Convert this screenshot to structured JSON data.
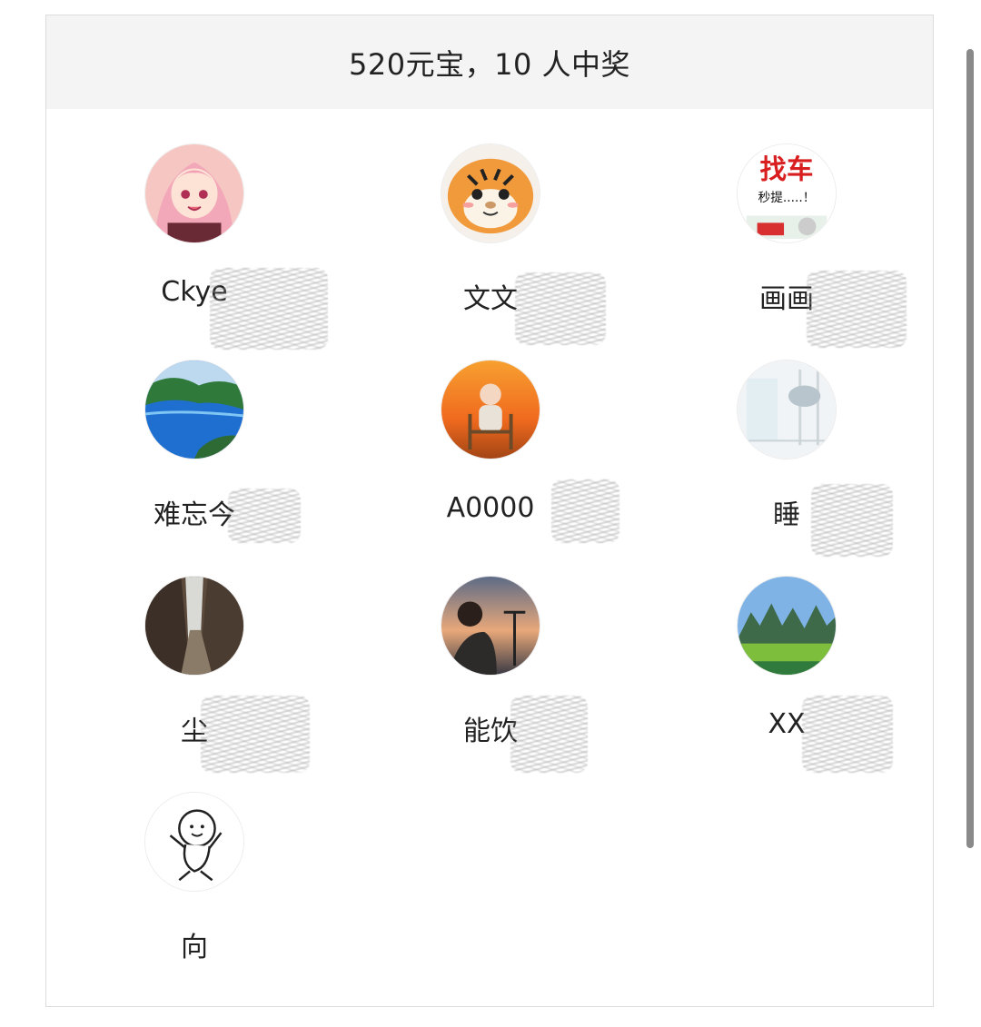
{
  "header": {
    "title": "520元宝，10 人中奖"
  },
  "winners": [
    {
      "name": "Ckye",
      "avatar": "anime-girl-avatar"
    },
    {
      "name": "文文",
      "avatar": "tiger-avatar"
    },
    {
      "name": "画画",
      "avatar": "car-ad-avatar"
    },
    {
      "name": "难忘今",
      "avatar": "seaside-avatar"
    },
    {
      "name": "A0000",
      "avatar": "sunset-baby-avatar"
    },
    {
      "name": "睡",
      "avatar": "white-room-avatar"
    },
    {
      "name": "尘",
      "avatar": "old-alley-avatar"
    },
    {
      "name": "能饮",
      "avatar": "man-sunset-avatar"
    },
    {
      "name": "XX",
      "avatar": "mountain-avatar"
    },
    {
      "name": "向",
      "avatar": "cartoon-doodle-avatar"
    }
  ],
  "avatar_texts": {
    "car_title": "找车",
    "car_sub": "秒提.....！"
  },
  "colors": {
    "header_bg": "#f4f4f4",
    "text": "#222222",
    "border": "#dcdcdc"
  }
}
